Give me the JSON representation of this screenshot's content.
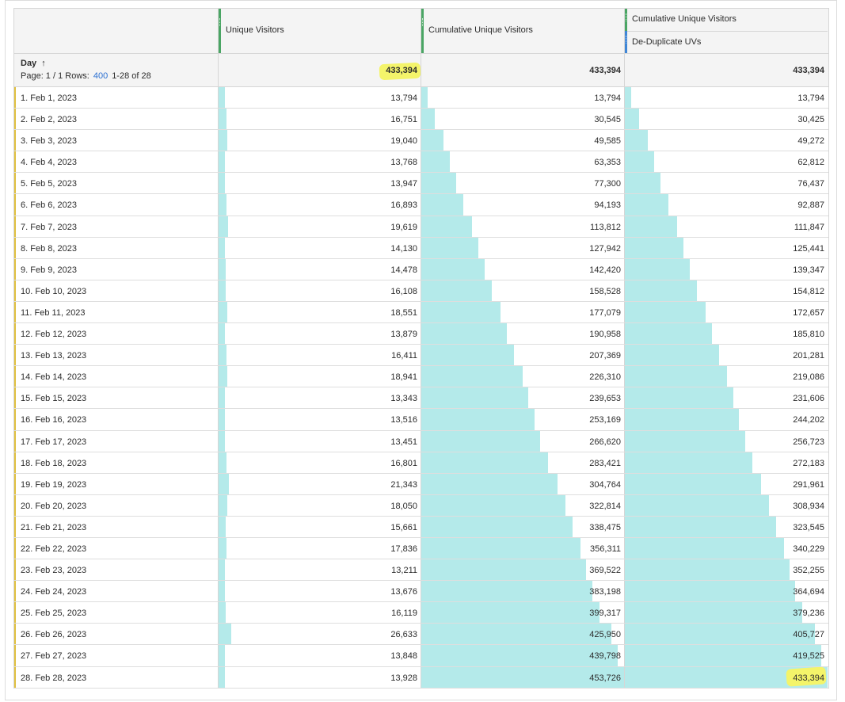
{
  "headers": {
    "unique_visitors": "Unique Visitors",
    "cumulative": "Cumulative Unique Visitors",
    "cumulative_dedup_top": "Cumulative Unique Visitors",
    "cumulative_dedup_bottom": "De-Duplicate UVs"
  },
  "dimension": {
    "label": "Day",
    "sort_icon": "sort-ascending-arrow",
    "sort_arrow": "↑",
    "page_label": "Page: 1 / 1 Rows:",
    "rows_value": "400",
    "range": "1-28 of 28"
  },
  "totals": {
    "uv": "433,394",
    "cum": "433,394",
    "dedup": "433,394"
  },
  "highlight_color": "#f4f46a",
  "bar_color": "#b4eaea",
  "max_values": {
    "uv": 433394,
    "cum": 453726,
    "dedup": 433394
  },
  "rows": [
    {
      "day": "1.  Feb 1, 2023",
      "uv": "13,794",
      "cum": "13,794",
      "dedup": "13,794",
      "uv_n": 13794,
      "cum_n": 13794,
      "dedup_n": 13794
    },
    {
      "day": "2.  Feb 2, 2023",
      "uv": "16,751",
      "cum": "30,545",
      "dedup": "30,425",
      "uv_n": 16751,
      "cum_n": 30545,
      "dedup_n": 30425
    },
    {
      "day": "3.  Feb 3, 2023",
      "uv": "19,040",
      "cum": "49,585",
      "dedup": "49,272",
      "uv_n": 19040,
      "cum_n": 49585,
      "dedup_n": 49272
    },
    {
      "day": "4.  Feb 4, 2023",
      "uv": "13,768",
      "cum": "63,353",
      "dedup": "62,812",
      "uv_n": 13768,
      "cum_n": 63353,
      "dedup_n": 62812
    },
    {
      "day": "5.  Feb 5, 2023",
      "uv": "13,947",
      "cum": "77,300",
      "dedup": "76,437",
      "uv_n": 13947,
      "cum_n": 77300,
      "dedup_n": 76437
    },
    {
      "day": "6.  Feb 6, 2023",
      "uv": "16,893",
      "cum": "94,193",
      "dedup": "92,887",
      "uv_n": 16893,
      "cum_n": 94193,
      "dedup_n": 92887
    },
    {
      "day": "7.  Feb 7, 2023",
      "uv": "19,619",
      "cum": "113,812",
      "dedup": "111,847",
      "uv_n": 19619,
      "cum_n": 113812,
      "dedup_n": 111847
    },
    {
      "day": "8.  Feb 8, 2023",
      "uv": "14,130",
      "cum": "127,942",
      "dedup": "125,441",
      "uv_n": 14130,
      "cum_n": 127942,
      "dedup_n": 125441
    },
    {
      "day": "9.  Feb 9, 2023",
      "uv": "14,478",
      "cum": "142,420",
      "dedup": "139,347",
      "uv_n": 14478,
      "cum_n": 142420,
      "dedup_n": 139347
    },
    {
      "day": "10.  Feb 10, 2023",
      "uv": "16,108",
      "cum": "158,528",
      "dedup": "154,812",
      "uv_n": 16108,
      "cum_n": 158528,
      "dedup_n": 154812
    },
    {
      "day": "11.  Feb 11, 2023",
      "uv": "18,551",
      "cum": "177,079",
      "dedup": "172,657",
      "uv_n": 18551,
      "cum_n": 177079,
      "dedup_n": 172657
    },
    {
      "day": "12.  Feb 12, 2023",
      "uv": "13,879",
      "cum": "190,958",
      "dedup": "185,810",
      "uv_n": 13879,
      "cum_n": 190958,
      "dedup_n": 185810
    },
    {
      "day": "13.  Feb 13, 2023",
      "uv": "16,411",
      "cum": "207,369",
      "dedup": "201,281",
      "uv_n": 16411,
      "cum_n": 207369,
      "dedup_n": 201281
    },
    {
      "day": "14.  Feb 14, 2023",
      "uv": "18,941",
      "cum": "226,310",
      "dedup": "219,086",
      "uv_n": 18941,
      "cum_n": 226310,
      "dedup_n": 219086
    },
    {
      "day": "15.  Feb 15, 2023",
      "uv": "13,343",
      "cum": "239,653",
      "dedup": "231,606",
      "uv_n": 13343,
      "cum_n": 239653,
      "dedup_n": 231606
    },
    {
      "day": "16.  Feb 16, 2023",
      "uv": "13,516",
      "cum": "253,169",
      "dedup": "244,202",
      "uv_n": 13516,
      "cum_n": 253169,
      "dedup_n": 244202
    },
    {
      "day": "17.  Feb 17, 2023",
      "uv": "13,451",
      "cum": "266,620",
      "dedup": "256,723",
      "uv_n": 13451,
      "cum_n": 266620,
      "dedup_n": 256723
    },
    {
      "day": "18.  Feb 18, 2023",
      "uv": "16,801",
      "cum": "283,421",
      "dedup": "272,183",
      "uv_n": 16801,
      "cum_n": 283421,
      "dedup_n": 272183
    },
    {
      "day": "19.  Feb 19, 2023",
      "uv": "21,343",
      "cum": "304,764",
      "dedup": "291,961",
      "uv_n": 21343,
      "cum_n": 304764,
      "dedup_n": 291961
    },
    {
      "day": "20.  Feb 20, 2023",
      "uv": "18,050",
      "cum": "322,814",
      "dedup": "308,934",
      "uv_n": 18050,
      "cum_n": 322814,
      "dedup_n": 308934
    },
    {
      "day": "21.  Feb 21, 2023",
      "uv": "15,661",
      "cum": "338,475",
      "dedup": "323,545",
      "uv_n": 15661,
      "cum_n": 338475,
      "dedup_n": 323545
    },
    {
      "day": "22.  Feb 22, 2023",
      "uv": "17,836",
      "cum": "356,311",
      "dedup": "340,229",
      "uv_n": 17836,
      "cum_n": 356311,
      "dedup_n": 340229
    },
    {
      "day": "23.  Feb 23, 2023",
      "uv": "13,211",
      "cum": "369,522",
      "dedup": "352,255",
      "uv_n": 13211,
      "cum_n": 369522,
      "dedup_n": 352255
    },
    {
      "day": "24.  Feb 24, 2023",
      "uv": "13,676",
      "cum": "383,198",
      "dedup": "364,694",
      "uv_n": 13676,
      "cum_n": 383198,
      "dedup_n": 364694
    },
    {
      "day": "25.  Feb 25, 2023",
      "uv": "16,119",
      "cum": "399,317",
      "dedup": "379,236",
      "uv_n": 16119,
      "cum_n": 399317,
      "dedup_n": 379236
    },
    {
      "day": "26.  Feb 26, 2023",
      "uv": "26,633",
      "cum": "425,950",
      "dedup": "405,727",
      "uv_n": 26633,
      "cum_n": 425950,
      "dedup_n": 405727
    },
    {
      "day": "27.  Feb 27, 2023",
      "uv": "13,848",
      "cum": "439,798",
      "dedup": "419,525",
      "uv_n": 13848,
      "cum_n": 439798,
      "dedup_n": 419525
    },
    {
      "day": "28.  Feb 28, 2023",
      "uv": "13,928",
      "cum": "453,726",
      "dedup": "433,394",
      "uv_n": 13928,
      "cum_n": 453726,
      "dedup_n": 433394
    }
  ]
}
